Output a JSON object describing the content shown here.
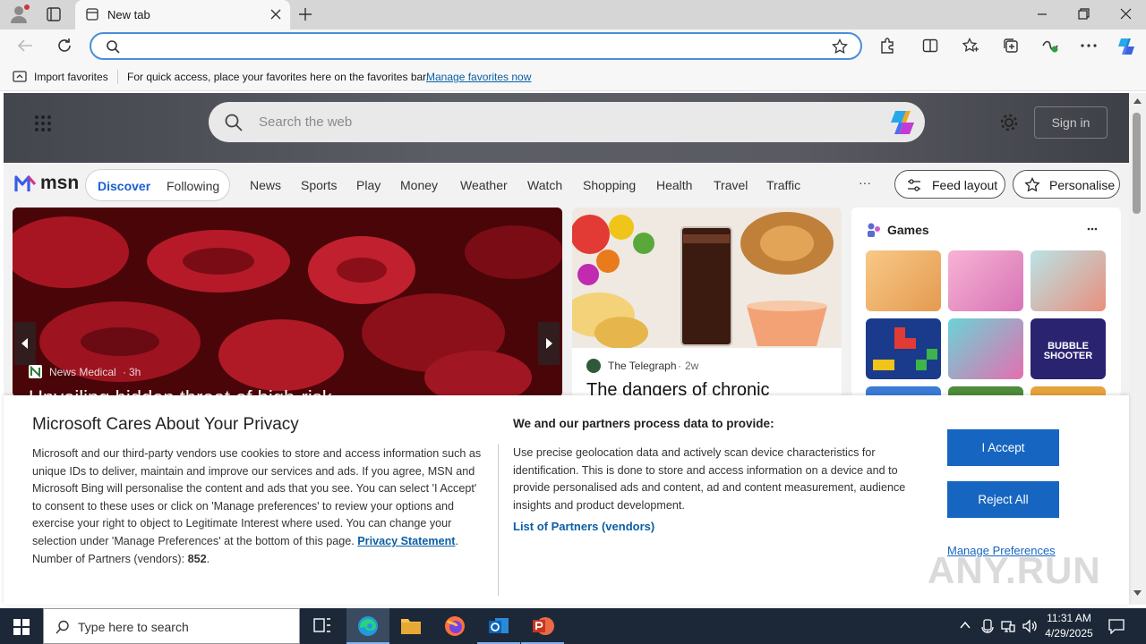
{
  "browser": {
    "tab_title": "New tab",
    "address_placeholder": "",
    "favorites_bar": {
      "import_label": "Import favorites",
      "hint": "For quick access, place your favorites here on the favorites bar.",
      "manage_link": "Manage favorites now"
    }
  },
  "msn": {
    "search_placeholder": "Search the web",
    "sign_in": "Sign in",
    "logo_text": "msn",
    "tabs": [
      "Discover",
      "Following"
    ],
    "nav": [
      "News",
      "Sports",
      "Play",
      "Money",
      "Weather",
      "Watch",
      "Shopping",
      "Health",
      "Travel",
      "Traffic"
    ],
    "more": "···",
    "feed_layout": "Feed layout",
    "personalise": "Personalise",
    "hero": {
      "source": "News Medical",
      "age": "3h",
      "headline_partial": "Unveiling hidden threat of high-risk..."
    },
    "mid": {
      "source": "The Telegraph",
      "age": "2w",
      "headline_partial": "The dangers of chronic"
    },
    "games": {
      "title": "Games",
      "tile_text": "BUBBLE SHOOTER"
    }
  },
  "privacy": {
    "title": "Microsoft Cares About Your Privacy",
    "body": "Microsoft and our third-party vendors use cookies to store and access information such as unique IDs to deliver, maintain and improve our services and ads. If you agree, MSN and Microsoft Bing will personalise the content and ads that you see. You can select 'I Accept' to consent to these uses or click on 'Manage preferences' to review your options and exercise your right to object to Legitimate Interest where used.  You can change your selection under 'Manage Preferences' at the bottom of this page.",
    "privacy_link": "Privacy Statement",
    "partners_label": "Number of Partners (vendors):",
    "partners_count": "852",
    "process_title": "We and our partners process data to provide:",
    "process_body": "Use precise geolocation data and actively scan device characteristics for identification. This is done to store and access information on a device and to provide personalised ads and content, ad and content measurement, audience insights and product development.",
    "partners_link": "List of Partners (vendors)",
    "accept": "I Accept",
    "reject": "Reject All",
    "manage": "Manage Preferences"
  },
  "taskbar": {
    "search_placeholder": "Type here to search",
    "time": "11:31 AM",
    "date": "4/29/2025"
  },
  "watermark": "ANY.RUN"
}
